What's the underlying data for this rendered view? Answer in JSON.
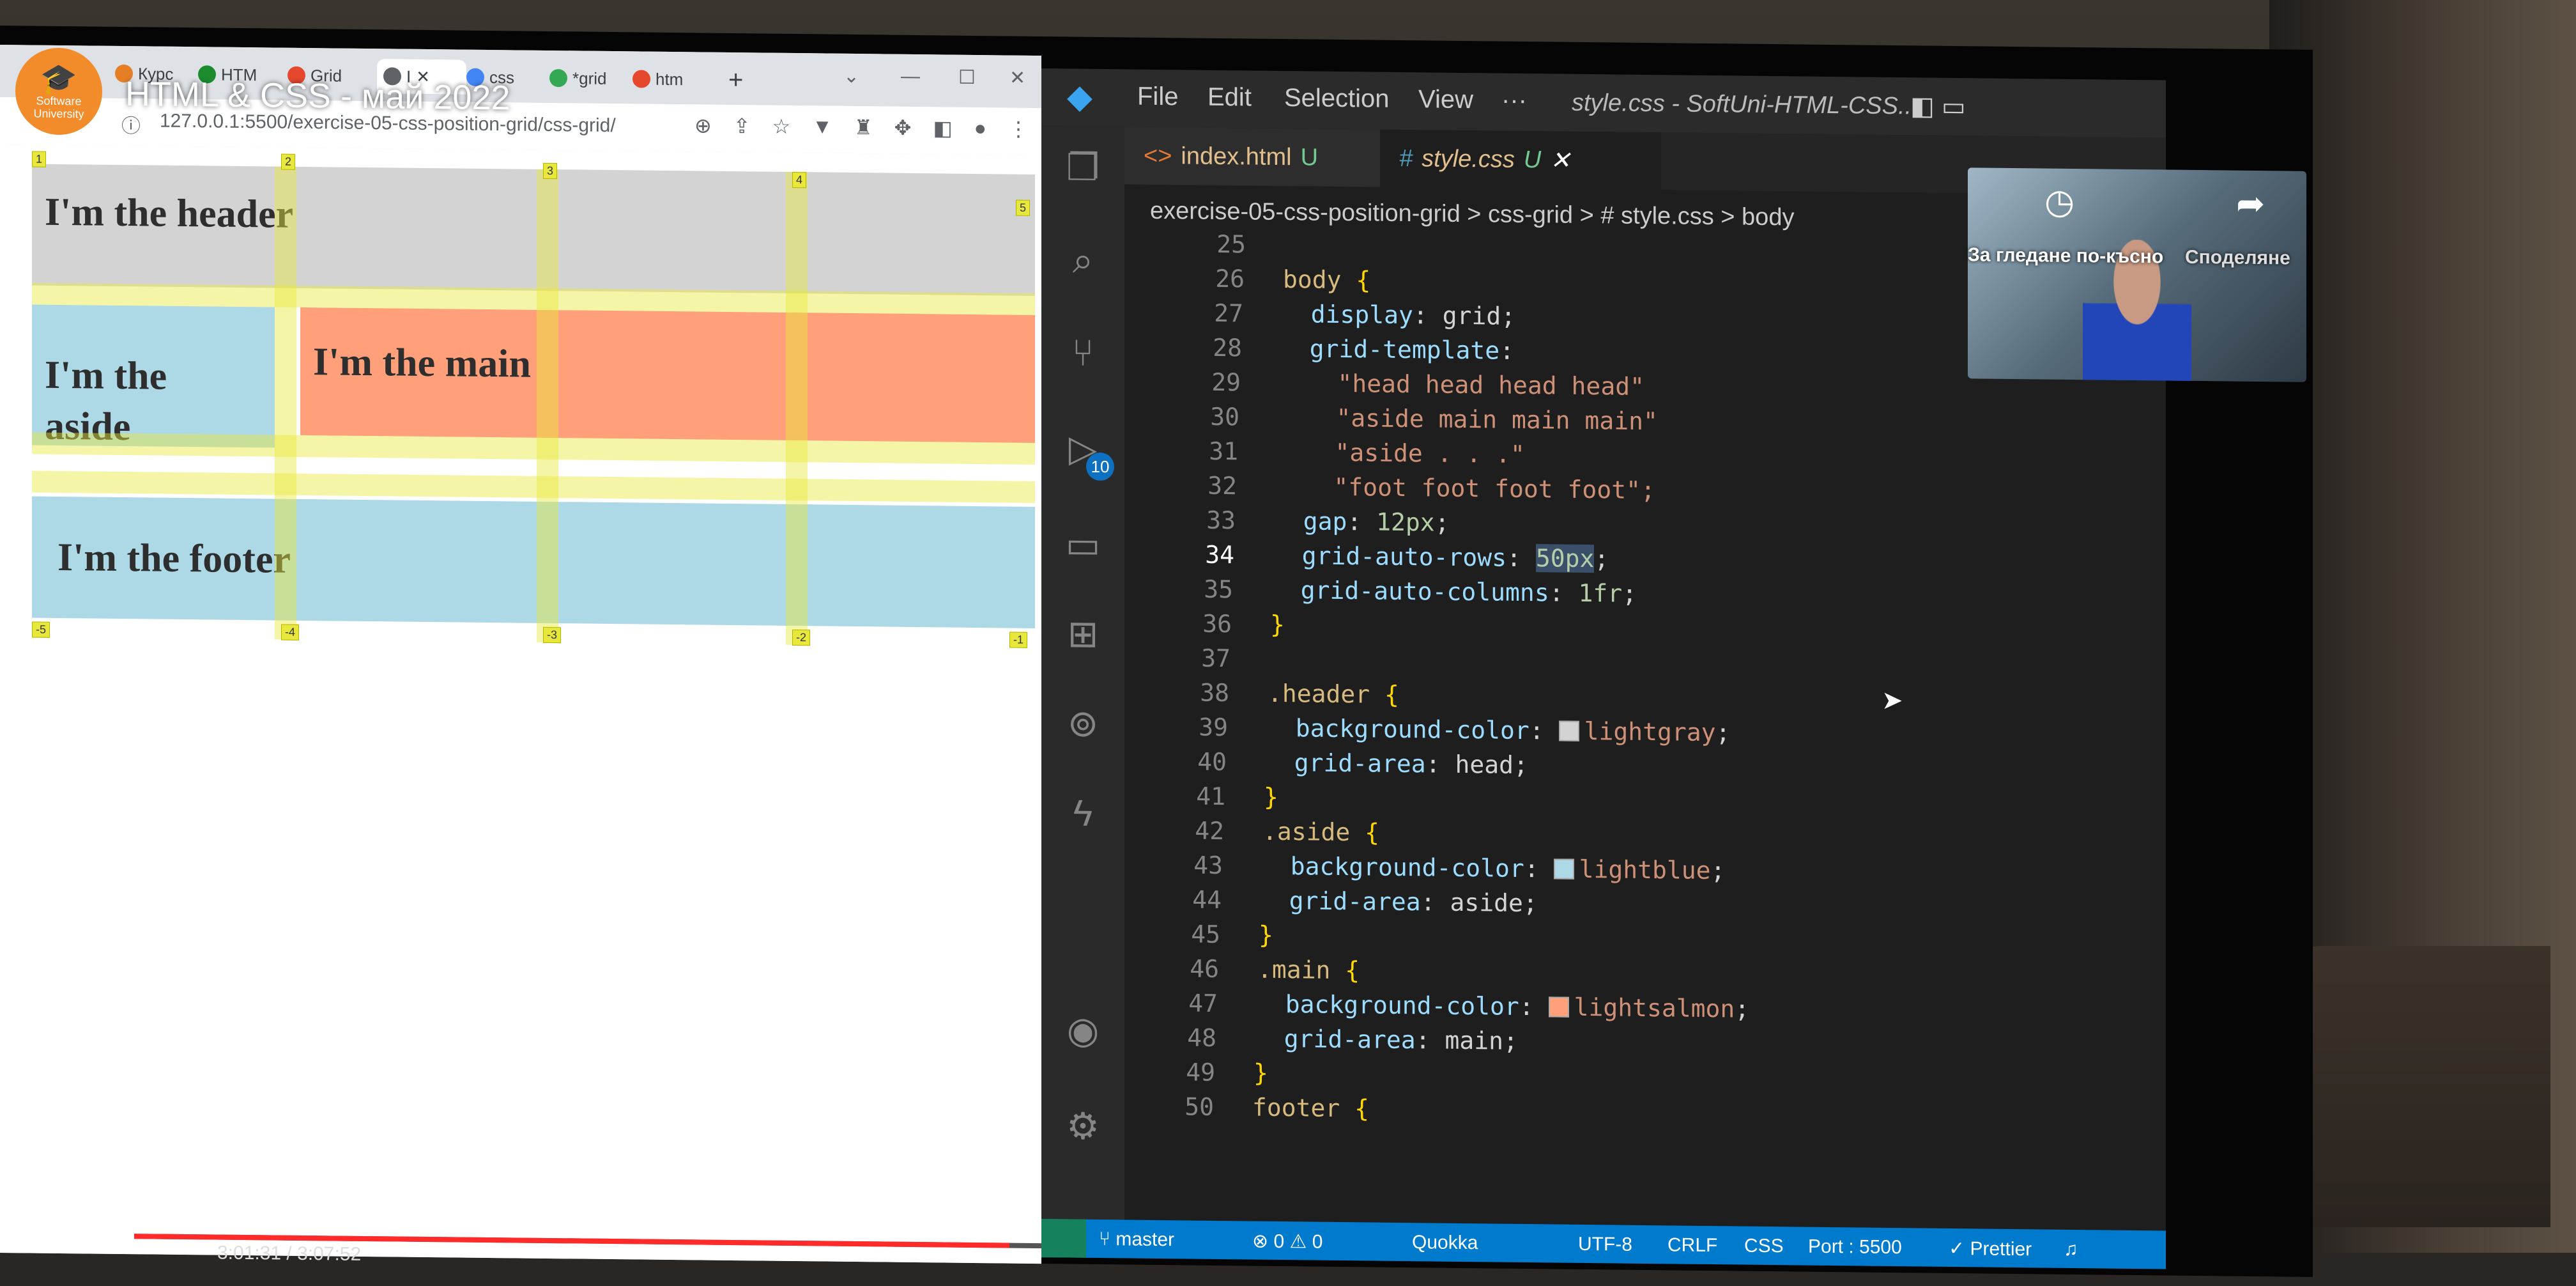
{
  "logo": {
    "line1": "Software",
    "line2": "University"
  },
  "video": {
    "title": "HTML & CSS - май 2022",
    "time": "3:01:31 / 3:07:52",
    "progress": 0.965
  },
  "browser": {
    "tabs": [
      "Курс",
      "HTM",
      "Grid",
      "I",
      "css",
      "*grid",
      "htm"
    ],
    "url": "127.0.0.1:5500/exercise-05-css-position-grid/css-grid/",
    "page": {
      "header": "I'm the header",
      "aside": "I'm the aside",
      "main": "I'm the main",
      "footer": "I'm the footer"
    },
    "grid_numbers": [
      "1",
      "2",
      "3",
      "4",
      "5",
      "-5",
      "-4",
      "-3",
      "-2",
      "-1"
    ]
  },
  "vscode": {
    "menu": [
      "File",
      "Edit",
      "Selection",
      "View",
      "···"
    ],
    "window_title": "style.css - SoftUni-HTML-CSS...",
    "source_control_badge": "10",
    "tabs": [
      {
        "label": "index.html",
        "status": "U",
        "icon": "html-icon"
      },
      {
        "label": "style.css",
        "status": "U",
        "icon": "css-icon"
      }
    ],
    "breadcrumb": "exercise-05-css-position-grid  >  css-grid  >  # style.css  >  body",
    "status": {
      "branch": "master",
      "errors": "0",
      "warnings": "0",
      "errors_warnings": "⊗ 0 ⚠ 0",
      "quokka": "Quokka",
      "encoding": "UTF-8",
      "eol": "CRLF",
      "lang": "CSS",
      "port": "Port : 5500",
      "prettier": "✓ Prettier"
    },
    "code": [
      {
        "n": "25",
        "t": ""
      },
      {
        "n": "26",
        "t": "body {"
      },
      {
        "n": "27",
        "t": "  display: grid;"
      },
      {
        "n": "28",
        "t": "  grid-template:"
      },
      {
        "n": "29",
        "t": "    \"head head head head\""
      },
      {
        "n": "30",
        "t": "    \"aside main main main\""
      },
      {
        "n": "31",
        "t": "    \"aside . . .\""
      },
      {
        "n": "32",
        "t": "    \"foot foot foot foot\";"
      },
      {
        "n": "33",
        "t": "  gap: 12px;"
      },
      {
        "n": "34",
        "t": "  grid-auto-rows: 50px;"
      },
      {
        "n": "35",
        "t": "  grid-auto-columns: 1fr;"
      },
      {
        "n": "36",
        "t": "}"
      },
      {
        "n": "37",
        "t": ""
      },
      {
        "n": "38",
        "t": ".header {"
      },
      {
        "n": "39",
        "t": "  background-color: lightgray;"
      },
      {
        "n": "40",
        "t": "  grid-area: head;"
      },
      {
        "n": "41",
        "t": "}"
      },
      {
        "n": "42",
        "t": ".aside {"
      },
      {
        "n": "43",
        "t": "  background-color: lightblue;"
      },
      {
        "n": "44",
        "t": "  grid-area: aside;"
      },
      {
        "n": "45",
        "t": "}"
      },
      {
        "n": "46",
        "t": ".main {"
      },
      {
        "n": "47",
        "t": "  background-color: lightsalmon;"
      },
      {
        "n": "48",
        "t": "  grid-area: main;"
      },
      {
        "n": "49",
        "t": "}"
      },
      {
        "n": "50",
        "t": "footer {"
      }
    ]
  },
  "webcam": {
    "watch_later": "За гледане по-късно",
    "share": "Споделяне"
  },
  "colors": {
    "lightgray": "#d3d3d3",
    "lightblue": "#add8e6",
    "lightsalmon": "#ffa07a",
    "accent": "#007acc"
  }
}
